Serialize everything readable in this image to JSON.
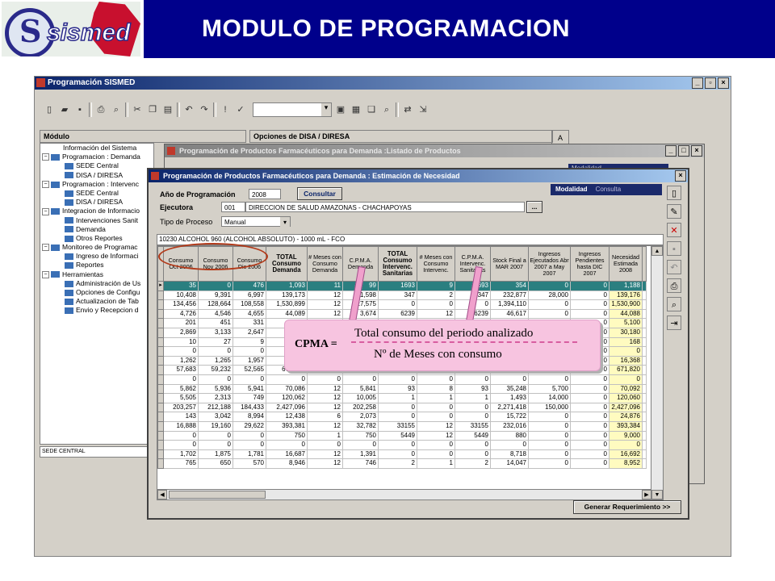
{
  "banner": {
    "title": "MODULO DE PROGRAMACION",
    "logo_text": "sismed"
  },
  "app": {
    "title": "Programación SISMED",
    "modulo_header": "Módulo",
    "opciones_header": "Opciones de DISA / DIRESA",
    "tab_a": "A",
    "status": "SEDE CENTRAL",
    "tree": [
      {
        "label": "Información del Sistema",
        "level": 1,
        "pm": ""
      },
      {
        "label": "Programacion : Demanda",
        "level": 0,
        "pm": "−"
      },
      {
        "label": "SEDE Central",
        "level": 2,
        "pm": ""
      },
      {
        "label": "DISA / DIRESA",
        "level": 2,
        "pm": ""
      },
      {
        "label": "Programacion : Intervenc",
        "level": 0,
        "pm": "−"
      },
      {
        "label": "SEDE Central",
        "level": 2,
        "pm": ""
      },
      {
        "label": "DISA / DIRESA",
        "level": 2,
        "pm": ""
      },
      {
        "label": "Integracion de Informacio",
        "level": 0,
        "pm": "−"
      },
      {
        "label": "Intervenciones Sanit",
        "level": 2,
        "pm": ""
      },
      {
        "label": "Demanda",
        "level": 2,
        "pm": ""
      },
      {
        "label": "Otros Reportes",
        "level": 2,
        "pm": ""
      },
      {
        "label": "Monitoreo de Programac",
        "level": 0,
        "pm": "−"
      },
      {
        "label": "Ingreso de Informaci",
        "level": 2,
        "pm": ""
      },
      {
        "label": "Reportes",
        "level": 2,
        "pm": ""
      },
      {
        "label": "Herramientas",
        "level": 0,
        "pm": "−"
      },
      {
        "label": "Administración de Us",
        "level": 2,
        "pm": ""
      },
      {
        "label": "Opciones de Configu",
        "level": 2,
        "pm": ""
      },
      {
        "label": "Actualizacion de Tab",
        "level": 2,
        "pm": ""
      },
      {
        "label": "Envio y Recepcion d",
        "level": 2,
        "pm": ""
      }
    ]
  },
  "win_listado": {
    "title": "Programación de Productos Farmacéuticos para Demanda :Listado de Productos",
    "tab": "Modalidad"
  },
  "win_estimacion": {
    "title": "Programación de Productos Farmacéuticos para Demanda : Estimación de Necesidad",
    "anio_label": "Año de Programación",
    "anio_value": "2008",
    "consultar": "Consultar",
    "ejecutora_label": "Ejecutora",
    "ejecutora_code": "001",
    "ejecutora_name": "DIRECCION DE SALUD AMAZONAS - CHACHAPOYAS",
    "ellipsis": "...",
    "tipo_label": "Tipo de Proceso",
    "tipo_value": "Manual",
    "modalidad_label": "Modalidad",
    "modalidad_value": "Consulta",
    "product": "10230  ALCOHOL 960 (ALCOHOL ABSOLUTO) - 1000 mL - FCO",
    "generar": "Generar Requerimiento >>"
  },
  "grid": {
    "columns": [
      {
        "label": "Consumo Oct 2006",
        "bold": false
      },
      {
        "label": "Consumo Nov 2006",
        "bold": false
      },
      {
        "label": "Consumo Dic 2006",
        "bold": false
      },
      {
        "label": "TOTAL Consumo Demanda",
        "bold": true
      },
      {
        "label": "# Meses con Consumo Demanda",
        "bold": false
      },
      {
        "label": "C.P.M.A. Demanda",
        "bold": false
      },
      {
        "label": "TOTAL Consumo Intervenc. Sanitarias",
        "bold": true
      },
      {
        "label": "# Meses con Consumo Intervenc.",
        "bold": false
      },
      {
        "label": "C.P.M.A. Intervenc. Sanitarias",
        "bold": false
      },
      {
        "label": "Stock Final a MAR 2007",
        "bold": false
      },
      {
        "label": "Ingresos Ejecutados Abr 2007 a May 2007",
        "bold": false
      },
      {
        "label": "Ingresos Pendientes hasta DIC 2007",
        "bold": false
      },
      {
        "label": "Necesidad Estimada 2008",
        "bold": false
      }
    ],
    "rows": [
      [
        "35",
        "0",
        "476",
        "1,093",
        "11",
        "99",
        "1693",
        "9",
        "1693",
        "354",
        "0",
        "0",
        "1,188"
      ],
      [
        "10,408",
        "9,391",
        "6,997",
        "139,173",
        "12",
        "11,598",
        "347",
        "2",
        "347",
        "232,877",
        "28,000",
        "0",
        "139,176"
      ],
      [
        "134,456",
        "128,664",
        "108,558",
        "1,530,899",
        "12",
        "127,575",
        "0",
        "0",
        "0",
        "1,394,110",
        "0",
        "0",
        "1,530,900"
      ],
      [
        "4,726",
        "4,546",
        "4,655",
        "44,089",
        "12",
        "3,674",
        "6239",
        "12",
        "6239",
        "46,617",
        "0",
        "0",
        "44,088"
      ],
      [
        "201",
        "451",
        "331",
        "",
        "",
        "",
        "",
        "",
        "",
        "",
        "",
        "0",
        "5,100"
      ],
      [
        "2,869",
        "3,133",
        "2,647",
        "",
        "",
        "",
        "",
        "",
        "",
        "",
        "",
        "0",
        "30,180"
      ],
      [
        "10",
        "27",
        "9",
        "",
        "",
        "",
        "",
        "",
        "",
        "",
        "",
        "0",
        "168"
      ],
      [
        "0",
        "0",
        "0",
        "",
        "",
        "",
        "",
        "",
        "",
        "",
        "",
        "0",
        "0"
      ],
      [
        "1,262",
        "1,265",
        "1,957",
        "",
        "",
        "",
        "",
        "",
        "",
        "",
        "",
        "0",
        "16,368"
      ],
      [
        "57,683",
        "59,232",
        "52,565",
        "671,820",
        "12",
        "55,985",
        "203673",
        "12",
        "203673",
        "955,290",
        "0",
        "0",
        "671,820"
      ],
      [
        "0",
        "0",
        "0",
        "0",
        "0",
        "0",
        "0",
        "0",
        "0",
        "0",
        "0",
        "0",
        "0"
      ],
      [
        "5,862",
        "5,936",
        "5,941",
        "70,086",
        "12",
        "5,841",
        "93",
        "8",
        "93",
        "35,248",
        "5,700",
        "0",
        "70,092"
      ],
      [
        "5,505",
        "2,313",
        "749",
        "120,062",
        "12",
        "10,005",
        "1",
        "1",
        "1",
        "1,493",
        "14,000",
        "0",
        "120,060"
      ],
      [
        "203,257",
        "212,188",
        "184,433",
        "2,427,096",
        "12",
        "202,258",
        "0",
        "0",
        "0",
        "2,271,418",
        "150,000",
        "0",
        "2,427,096"
      ],
      [
        "143",
        "3,042",
        "8,994",
        "12,438",
        "6",
        "2,073",
        "0",
        "0",
        "0",
        "15,722",
        "0",
        "0",
        "24,876"
      ],
      [
        "16,888",
        "19,160",
        "29,622",
        "393,381",
        "12",
        "32,782",
        "33155",
        "12",
        "33155",
        "232,016",
        "0",
        "0",
        "393,384"
      ],
      [
        "0",
        "0",
        "0",
        "750",
        "1",
        "750",
        "5449",
        "12",
        "5449",
        "880",
        "0",
        "0",
        "9,000"
      ],
      [
        "0",
        "0",
        "0",
        "0",
        "0",
        "0",
        "0",
        "0",
        "0",
        "0",
        "0",
        "0",
        "0"
      ],
      [
        "1,702",
        "1,875",
        "1,781",
        "16,687",
        "12",
        "1,391",
        "0",
        "0",
        "0",
        "8,718",
        "0",
        "0",
        "16,692"
      ],
      [
        "765",
        "650",
        "570",
        "8,946",
        "12",
        "746",
        "2",
        "1",
        "2",
        "14,047",
        "0",
        "0",
        "8,952"
      ]
    ]
  },
  "formula": {
    "lhs": "CPMA =",
    "numerator": "Total consumo del periodo analizado",
    "denominator": "Nº de Meses con consumo"
  }
}
